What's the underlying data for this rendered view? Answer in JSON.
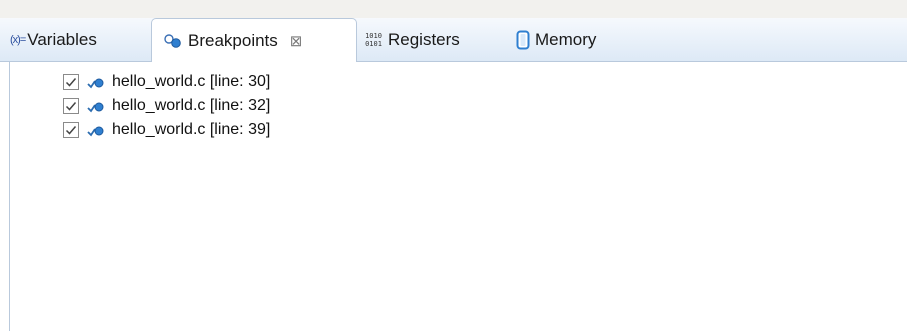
{
  "tabs": [
    {
      "label": "Variables",
      "icon": "variables-icon",
      "icon_text": "(x)="
    },
    {
      "label": "Breakpoints",
      "icon": "breakpoints-icon",
      "active": true
    },
    {
      "label": "Registers",
      "icon": "registers-icon",
      "icon_text": "1010\n0101"
    },
    {
      "label": "Memory",
      "icon": "memory-icon"
    }
  ],
  "close_glyph": "⊠",
  "breakpoints": [
    {
      "label": "hello_world.c [line: 30]",
      "checked": true
    },
    {
      "label": "hello_world.c [line: 32]",
      "checked": true
    },
    {
      "label": "hello_world.c [line: 39]",
      "checked": true
    }
  ],
  "colors": {
    "tab_gradient_top": "#f6f9fd",
    "tab_gradient_bottom": "#dde9f6",
    "border": "#b9c9dc",
    "icon_blue": "#2b6cb0"
  }
}
